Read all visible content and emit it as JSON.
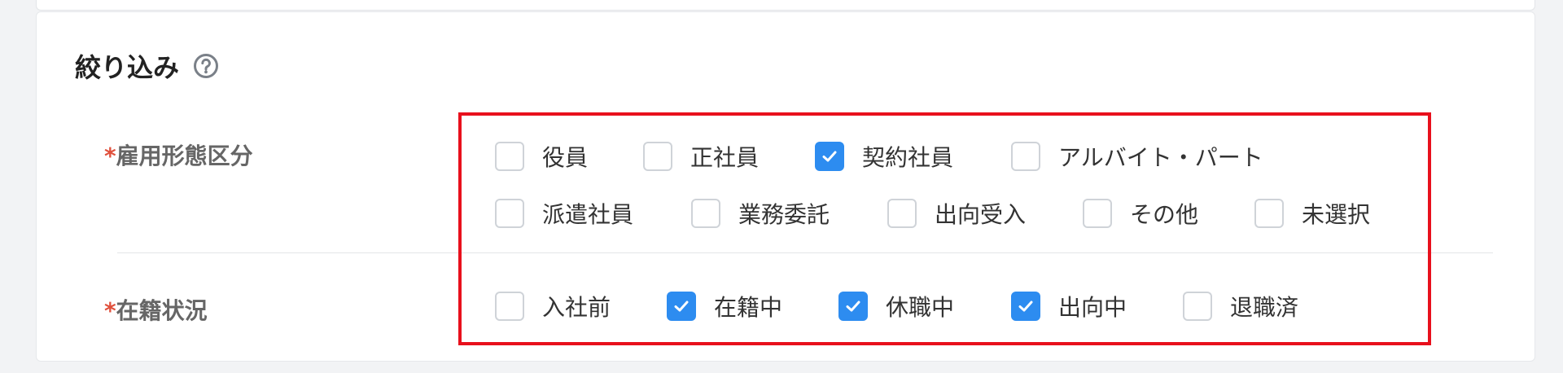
{
  "section": {
    "title": "絞り込み",
    "help_icon": "question-circle-icon"
  },
  "employment_type": {
    "required_mark": "*",
    "label": "雇用形態区分",
    "options": [
      {
        "label": "役員",
        "checked": false
      },
      {
        "label": "正社員",
        "checked": false
      },
      {
        "label": "契約社員",
        "checked": true
      },
      {
        "label": "アルバイト・パート",
        "checked": false
      },
      {
        "label": "派遣社員",
        "checked": false
      },
      {
        "label": "業務委託",
        "checked": false
      },
      {
        "label": "出向受入",
        "checked": false
      },
      {
        "label": "その他",
        "checked": false
      },
      {
        "label": "未選択",
        "checked": false
      }
    ]
  },
  "enrollment_status": {
    "required_mark": "*",
    "label": "在籍状況",
    "options": [
      {
        "label": "入社前",
        "checked": false
      },
      {
        "label": "在籍中",
        "checked": true
      },
      {
        "label": "休職中",
        "checked": true
      },
      {
        "label": "出向中",
        "checked": true
      },
      {
        "label": "退職済",
        "checked": false
      }
    ]
  },
  "colors": {
    "accent": "#2d8cf0",
    "required": "#e0503c",
    "highlight": "#e8101c"
  }
}
